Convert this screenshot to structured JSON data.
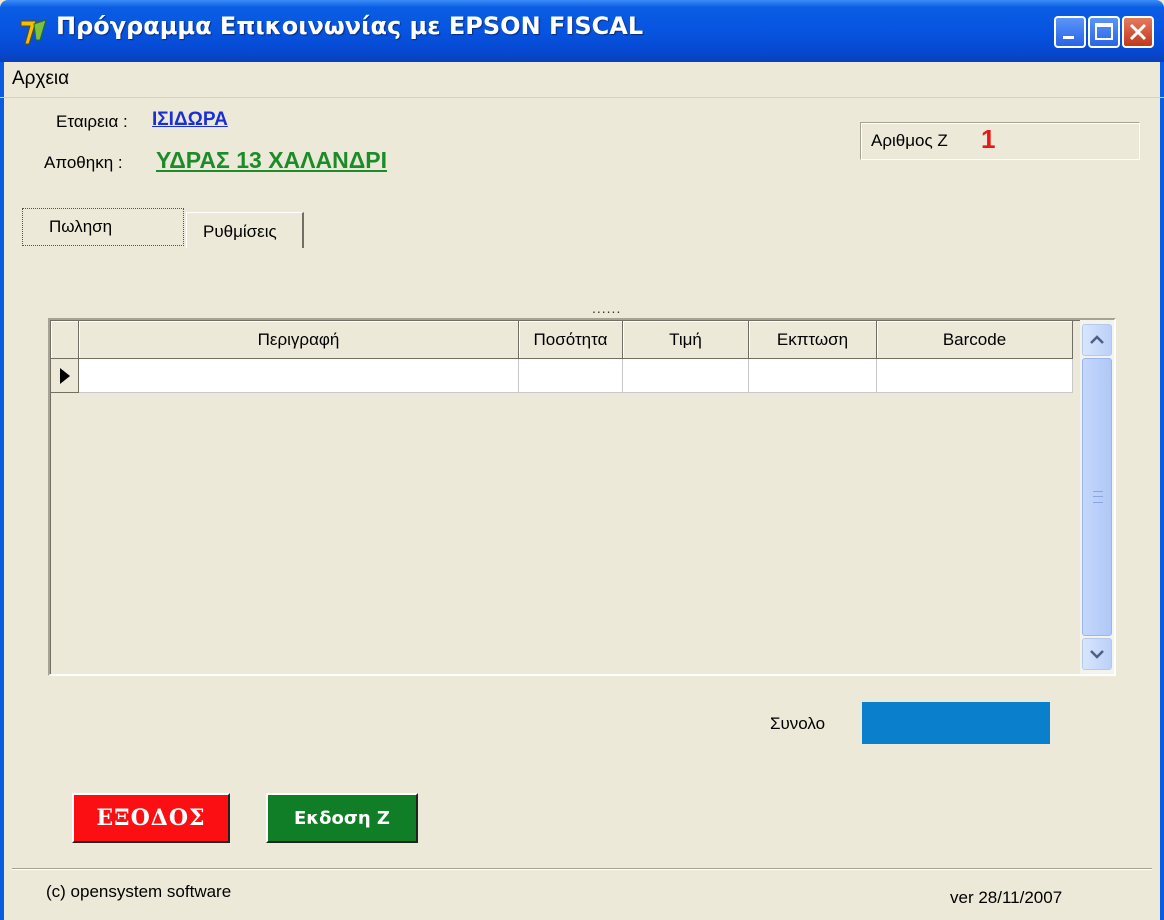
{
  "window": {
    "title": "Πρόγραμμα Επικοινωνίας με EPSON FISCAL",
    "icon": "app-logo-icon",
    "controls": [
      "minimize-icon",
      "maximize-icon",
      "close-icon"
    ]
  },
  "menu": {
    "items": [
      {
        "label": "Αρχεια"
      }
    ]
  },
  "header": {
    "company_label": "Εταιρεια :",
    "company_value": "ΙΣΙΔΩΡΑ",
    "warehouse_label": "Αποθηκη :",
    "warehouse_value": "ΥΔΡΑΣ 13 ΧΑΛΑΝΔΡΙ",
    "z_label": "Αριθμος Ζ",
    "z_value": "1"
  },
  "tabs": [
    {
      "label": "Πωληση",
      "active": true
    },
    {
      "label": "Ρυθμίσεις",
      "active": false
    }
  ],
  "grid": {
    "sort_indicator": "......",
    "columns": [
      "Περιγραφή",
      "Ποσότητα",
      "Τιμή",
      "Εκπτωση",
      "Barcode"
    ],
    "rows": [
      [
        "",
        "",
        "",
        "",
        ""
      ]
    ]
  },
  "total": {
    "label": "Συνολο",
    "value": ""
  },
  "buttons": {
    "exit_label": "ΕΞΟΔΟΣ",
    "z_label": "Εκδοση Ζ"
  },
  "footer": {
    "copyright": "(c) opensystem software",
    "version": "ver 28/11/2007"
  },
  "colors": {
    "company_value": "#1a2fd6",
    "warehouse_value": "#1c8b2a",
    "z_value": "#e81818",
    "total_box": "#0a80cc",
    "exit_button": "#fb0f12",
    "z_button": "#0f7e26"
  }
}
